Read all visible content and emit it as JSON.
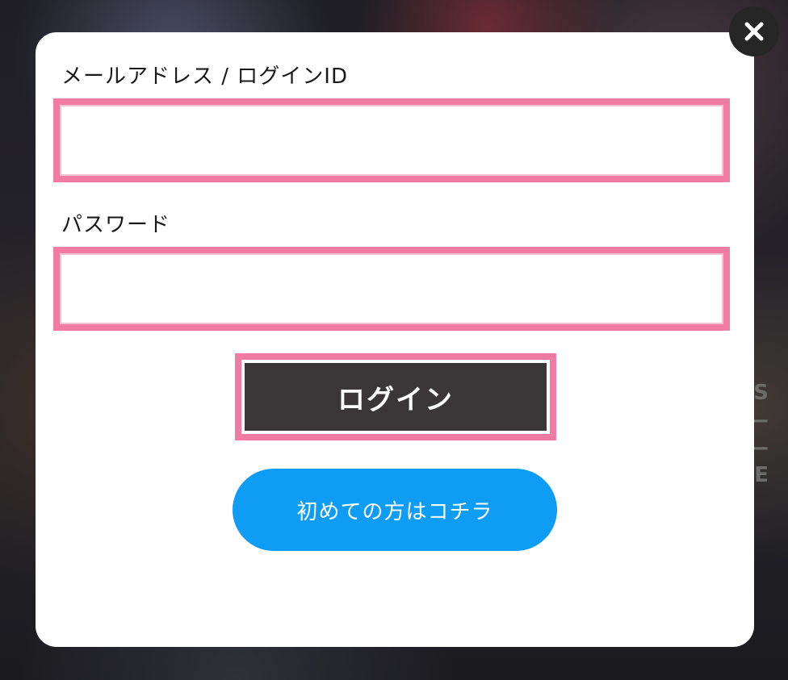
{
  "form": {
    "email_label": "メールアドレス / ログインID",
    "email_value": "",
    "password_label": "パスワード",
    "password_value": "",
    "login_button": "ログイン",
    "register_button": "初めての方はコチラ"
  },
  "background": {
    "decor_text": "S\n—\n—\nE"
  },
  "colors": {
    "highlight_border": "#f27ba3",
    "login_button_bg": "#3b3739",
    "register_button_bg": "#0f9cf4",
    "close_button_bg": "#262626"
  },
  "icons": {
    "close": "close-icon"
  }
}
